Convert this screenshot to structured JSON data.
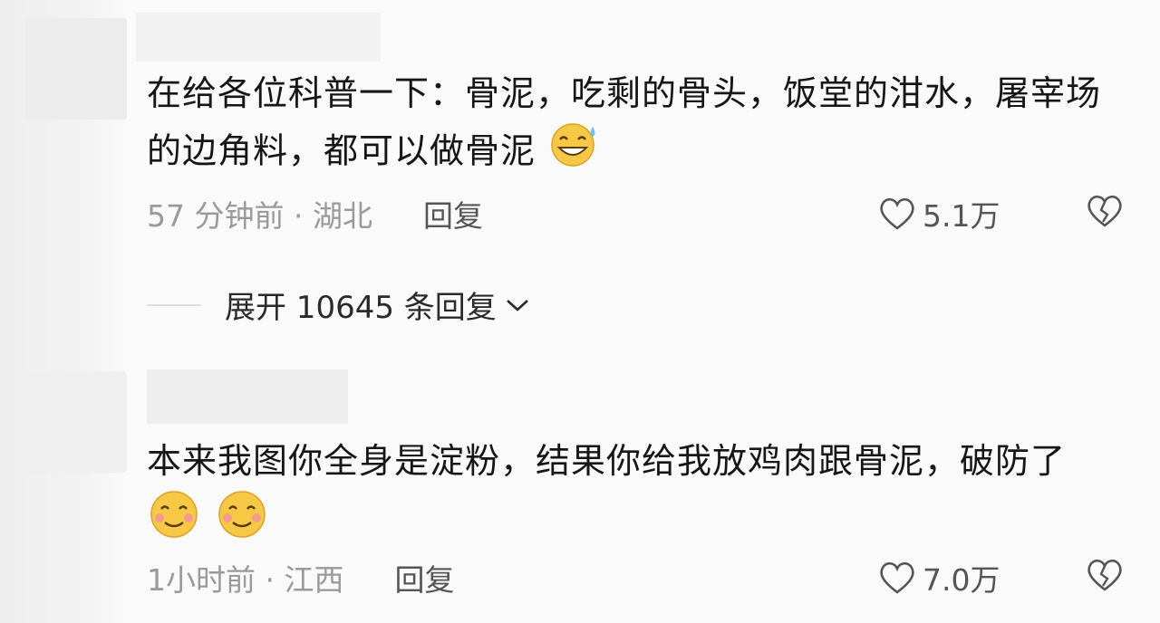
{
  "comments": [
    {
      "text": "在给各位科普一下：骨泥，吃剩的骨头，饭堂的泔水，屠宰场的边角料，都可以做骨泥",
      "emoji": [
        "grin-sweat-emoji"
      ],
      "time": "57 分钟前 · 湖北",
      "reply_label": "回复",
      "likes": "5.1万"
    },
    {
      "text": "本来我图你全身是淀粉，结果你给我放鸡肉跟骨泥，破防了",
      "emoji": [
        "blush-smile-emoji",
        "blush-smile-emoji"
      ],
      "time": "1小时前 · 江西",
      "reply_label": "回复",
      "likes": "7.0万"
    }
  ],
  "expand_replies": "展开 10645 条回复",
  "colors": {
    "text": "#161616",
    "meta": "#9a9a9a",
    "icon": "#555555"
  }
}
